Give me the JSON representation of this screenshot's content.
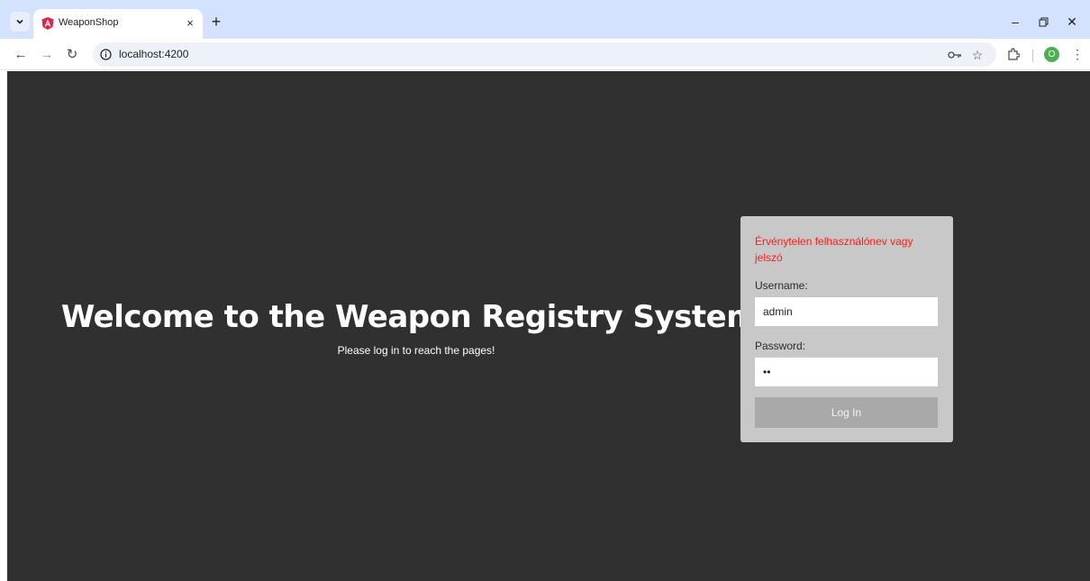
{
  "browser": {
    "tab": {
      "title": "WeaponShop",
      "close_icon": "×",
      "favicon": "angular-logo-icon"
    },
    "new_tab_icon": "+",
    "window_controls": {
      "minimize": "–",
      "restore": "▢",
      "close": "✕"
    },
    "toolbar": {
      "back": "←",
      "forward": "→",
      "reload": "↻",
      "url": "localhost:4200",
      "star": "☆",
      "profile_initial": "O",
      "menu": "⋮"
    }
  },
  "page": {
    "heading": "Welcome to the Weapon Registry System!",
    "subheading": "Please log in to reach the pages!",
    "login": {
      "error": "Érvénytelen felhasználónev vagy jelszó",
      "username_label": "Username:",
      "username_value": "admin",
      "password_label": "Password:",
      "password_value": "aa",
      "submit_label": "Log In"
    }
  },
  "colors": {
    "page_background": "#303030",
    "card_background": "#c8c8c8",
    "error_text": "#ff1a1a",
    "button_background": "#a9a9a9",
    "tabstrip_background": "#d3e3fd"
  }
}
